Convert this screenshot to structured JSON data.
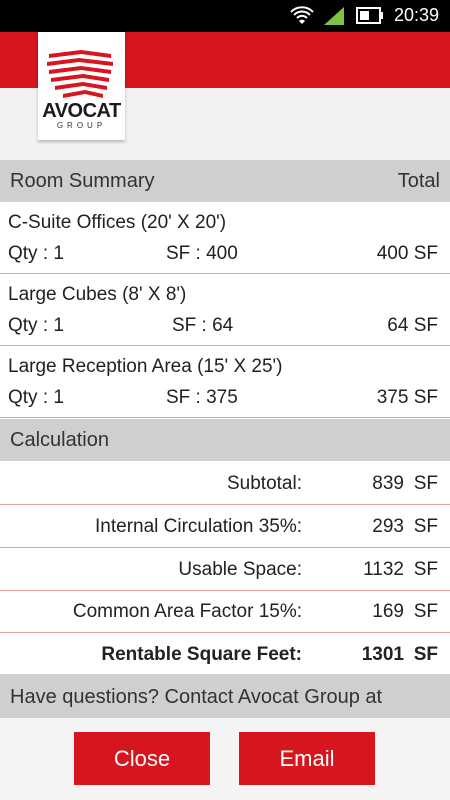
{
  "status_bar": {
    "time": "20:39",
    "icons": [
      "wifi-icon",
      "signal-icon",
      "battery-icon"
    ]
  },
  "brand": {
    "name": "AVOCAT",
    "sub": "GROUP",
    "accent_color": "#d7151e"
  },
  "room_summary": {
    "title": "Room Summary",
    "total_label": "Total",
    "rooms": [
      {
        "name": "C-Suite Offices (20' X 20')",
        "qty": "Qty : 1",
        "sf": "SF :  400",
        "total": "400  SF"
      },
      {
        "name": "Large Cubes (8' X 8')",
        "qty": "Qty : 1",
        "sf": "SF :  64",
        "total": "64  SF"
      },
      {
        "name": "Large Reception Area (15' X 25')",
        "qty": "Qty : 1",
        "sf": "SF :  375",
        "total": "375  SF"
      }
    ]
  },
  "calculation": {
    "title": "Calculation",
    "rows": [
      {
        "label": "Subtotal:",
        "value": "839",
        "unit": "SF"
      },
      {
        "label": "Internal Circulation 35%:",
        "value": "293",
        "unit": "SF"
      },
      {
        "label": "Usable Space:",
        "value": "1132",
        "unit": "SF"
      },
      {
        "label": "Common Area Factor 15%:",
        "value": "169",
        "unit": "SF"
      },
      {
        "label": "Rentable Square Feet:",
        "value": "1301",
        "unit": "SF"
      }
    ]
  },
  "footer": {
    "contact_text": "Have questions? Contact Avocat Group at",
    "close_label": "Close",
    "email_label": "Email"
  }
}
